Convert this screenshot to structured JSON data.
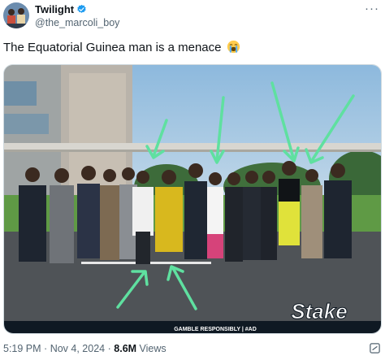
{
  "author": {
    "name": "Twilight",
    "handle": "@the_marcoli_boy"
  },
  "tweet": {
    "text": "The Equatorial Guinea man is a menace",
    "emoji": "loudly-crying-face"
  },
  "media": {
    "banner_text": "GAMBLE RESPONSIBLY  |  #AD",
    "brand_watermark": "Stake"
  },
  "meta": {
    "time": "5:19 PM",
    "separator": "·",
    "date": "Nov 4, 2024",
    "views_count": "8.6M",
    "views_label": "Views"
  },
  "icons": {
    "verified": "verified-badge-icon",
    "more": "more-options-icon",
    "grok": "grok-icon"
  },
  "colors": {
    "verified_blue": "#1d9bf0",
    "arrow_green": "#5fe0a0",
    "text_primary": "#0f1419",
    "text_secondary": "#536471"
  }
}
